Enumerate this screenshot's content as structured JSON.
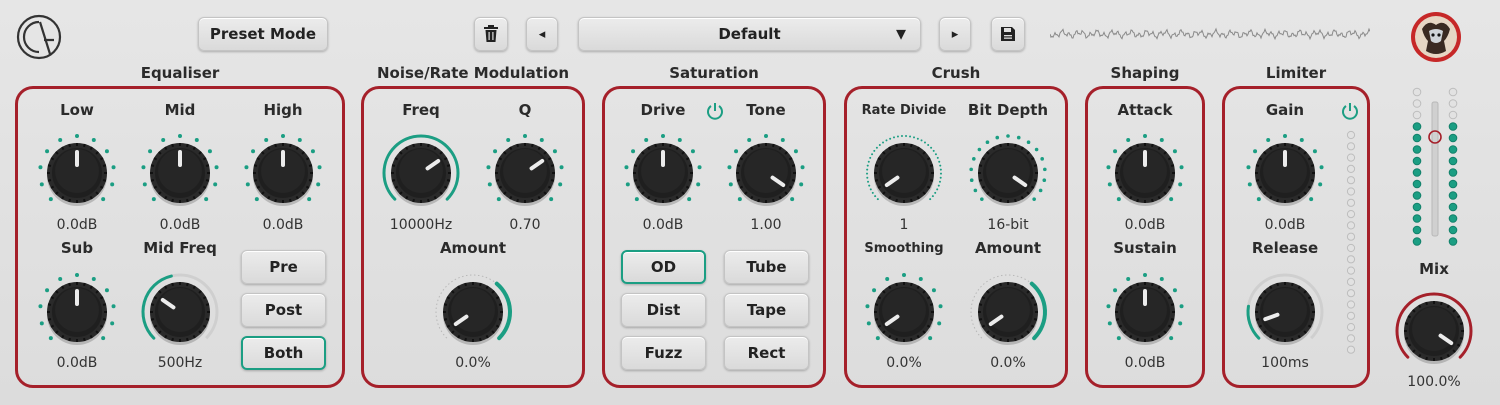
{
  "header": {
    "preset_mode_label": "Preset Mode",
    "preset_name": "Default",
    "prev_glyph": "◂",
    "next_glyph": "▸",
    "dropdown_glyph": "▾"
  },
  "colors": {
    "accent": "#1b9e83",
    "panel_border": "#a5202a",
    "knob": "#1c1c1c"
  },
  "equaliser": {
    "title": "Equaliser",
    "knobs": [
      {
        "label": "Low",
        "value": "0.0dB"
      },
      {
        "label": "Mid",
        "value": "0.0dB"
      },
      {
        "label": "High",
        "value": "0.0dB"
      },
      {
        "label": "Sub",
        "value": "0.0dB"
      },
      {
        "label": "Mid Freq",
        "value": "500Hz"
      }
    ],
    "modes": [
      "Pre",
      "Post",
      "Both"
    ],
    "active_mode": "Both"
  },
  "noise": {
    "title": "Noise/Rate Modulation",
    "knobs": [
      {
        "label": "Freq",
        "value": "10000Hz"
      },
      {
        "label": "Q",
        "value": "0.70"
      },
      {
        "label": "Amount",
        "value": "0.0%"
      }
    ]
  },
  "saturation": {
    "title": "Saturation",
    "knobs": [
      {
        "label": "Drive",
        "value": "0.0dB"
      },
      {
        "label": "Tone",
        "value": "1.00"
      }
    ],
    "modes": [
      "OD",
      "Tube",
      "Dist",
      "Tape",
      "Fuzz",
      "Rect"
    ],
    "active_mode": "OD"
  },
  "crush": {
    "title": "Crush",
    "knobs": [
      {
        "label": "Rate Divide",
        "value": "1"
      },
      {
        "label": "Bit Depth",
        "value": "16-bit"
      },
      {
        "label": "Smoothing",
        "value": "0.0%"
      },
      {
        "label": "Amount",
        "value": "0.0%"
      }
    ]
  },
  "shaping": {
    "title": "Shaping",
    "knobs": [
      {
        "label": "Attack",
        "value": "0.0dB"
      },
      {
        "label": "Sustain",
        "value": "0.0dB"
      }
    ]
  },
  "limiter": {
    "title": "Limiter",
    "knobs": [
      {
        "label": "Gain",
        "value": "0.0dB"
      },
      {
        "label": "Release",
        "value": "100ms"
      }
    ]
  },
  "mix": {
    "label": "Mix",
    "value": "100.0%"
  }
}
